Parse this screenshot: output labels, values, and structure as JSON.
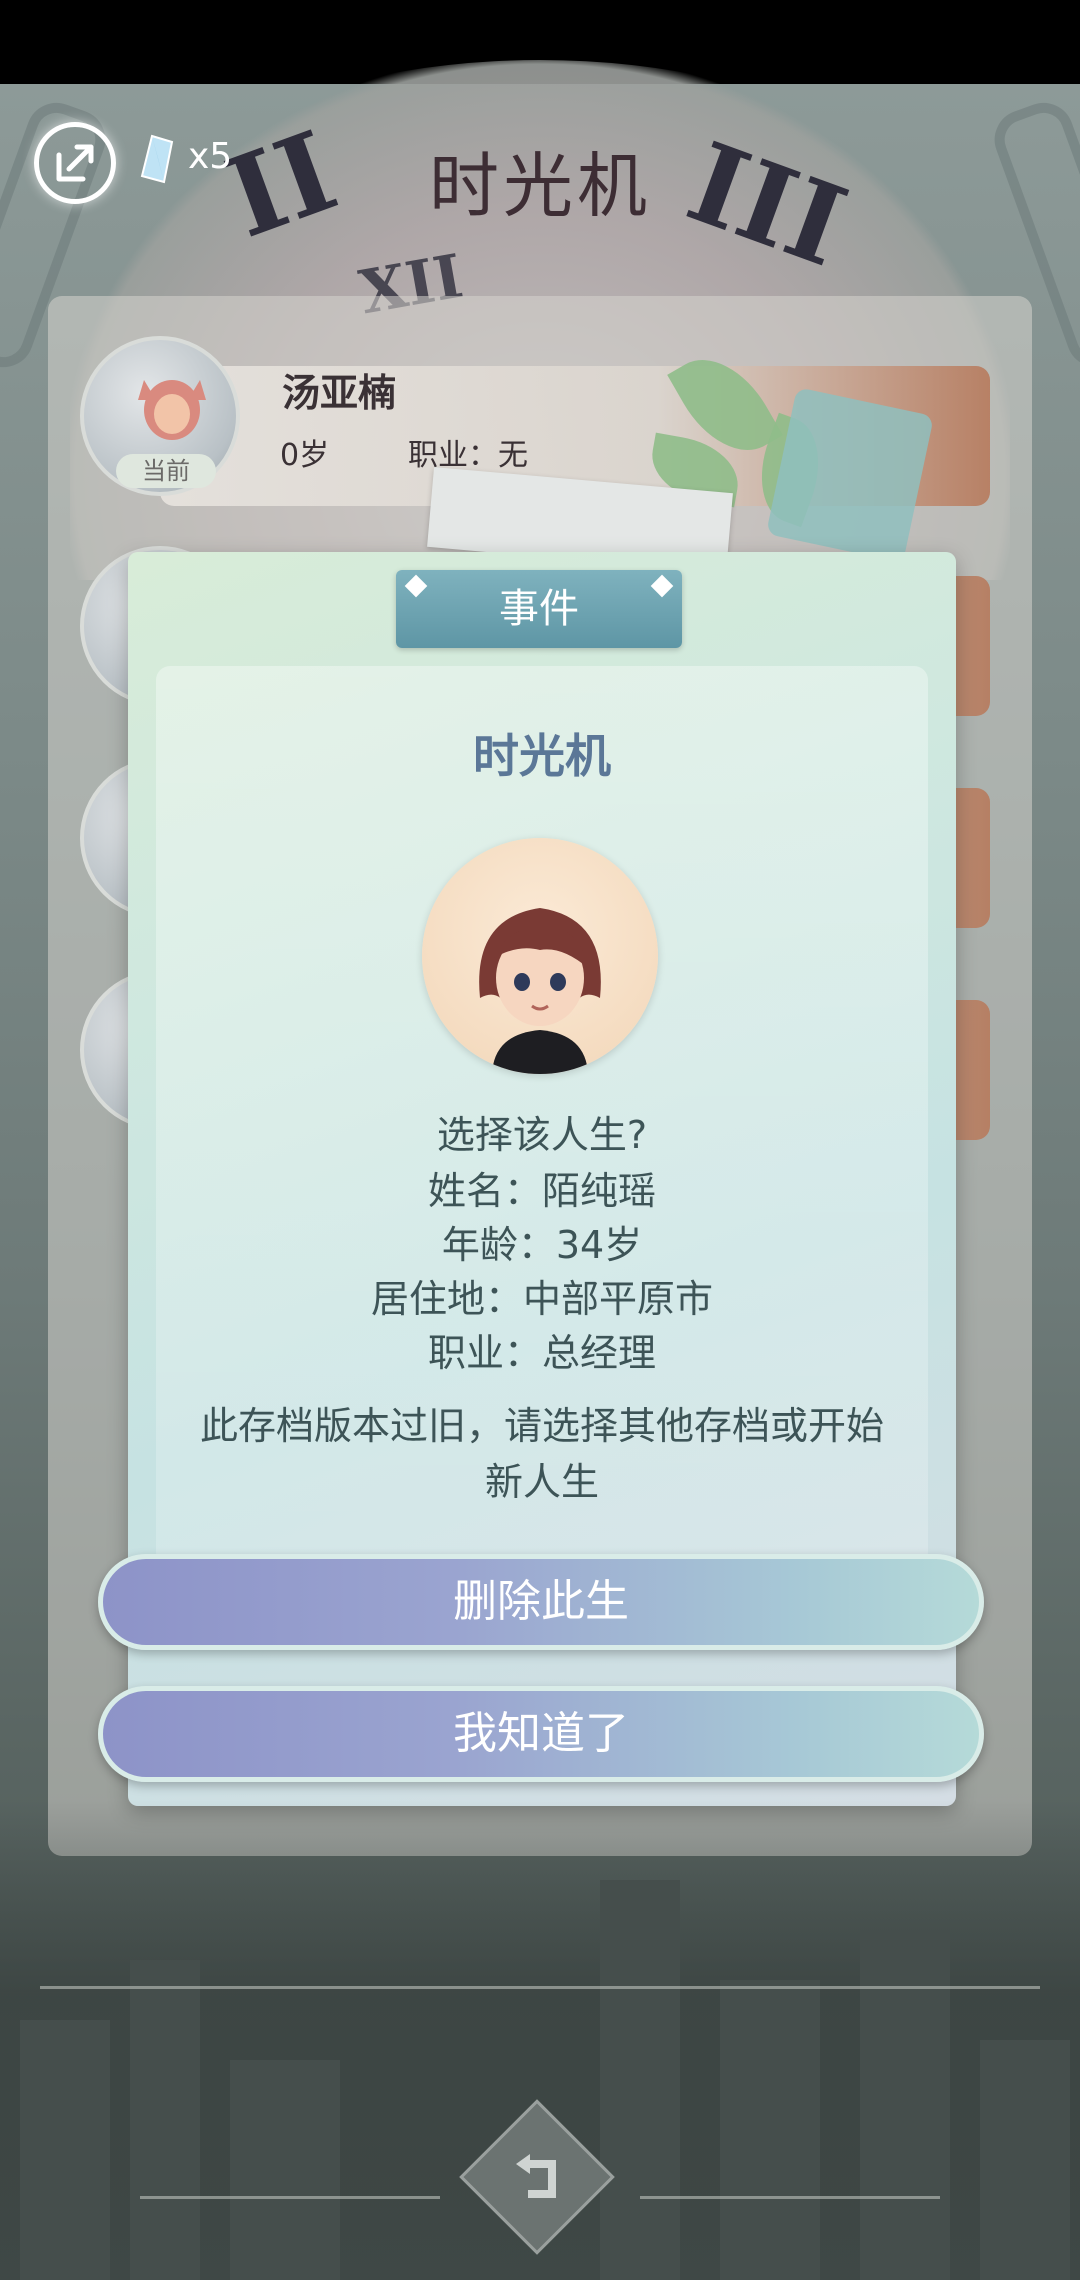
{
  "header": {
    "title": "时光机",
    "gem_count": "x5"
  },
  "current_life": {
    "name": "汤亚楠",
    "age": "0岁",
    "job": "职业：无",
    "badge": "当前"
  },
  "dialog": {
    "tab_label": "事件",
    "title": "时光机",
    "question": "选择该人生?",
    "name_line": "姓名：陌纯瑶",
    "age_line": "年龄：34岁",
    "residence_line": "居住地：中部平原市",
    "job_line": "职业：总经理",
    "warning": "此存档版本过旧，请选择其他存档或开始新人生",
    "delete_button": "删除此生",
    "ok_button": "我知道了"
  },
  "colors": {
    "accent_title": "#5b7797",
    "button_gradient_start": "#8d93c8",
    "button_gradient_end": "#b5dad8",
    "tab": "#6ea4b1"
  },
  "icons": {
    "exit": "exit-arrow-icon",
    "gem": "crystal-gem-icon",
    "back": "return-arrow-icon"
  }
}
